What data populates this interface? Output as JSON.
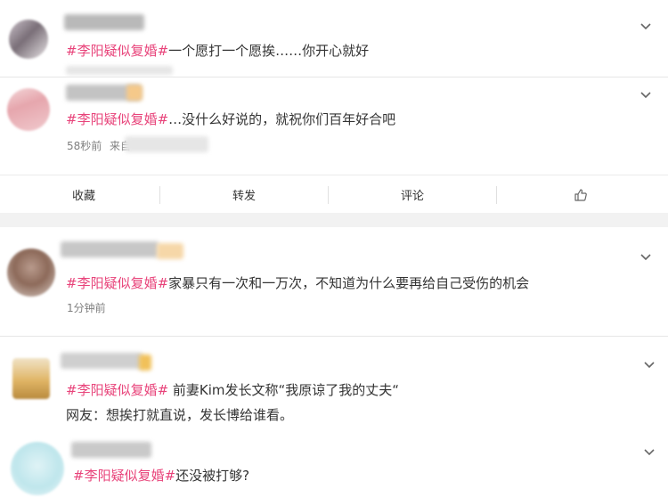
{
  "posts": [
    {
      "tag": "#李阳疑似复婚#",
      "text": "一个愿打一个愿挨……你开心就好"
    },
    {
      "tag": "#李阳疑似复婚#",
      "text": "…没什么好说的，就祝你们百年好合吧",
      "time": "58秒前",
      "source": "来自"
    },
    {
      "tag": "#李阳疑似复婚#",
      "text": "家暴只有一次和一万次，不知道为什么要再给自己受伤的机会",
      "time": "1分钟前"
    },
    {
      "tag": "#李阳疑似复婚#",
      "text": " 前妻Kim发长文称“我原谅了我的丈夫“",
      "line2": "网友：想挨打就直说，发长博给谁看。"
    },
    {
      "tag": "#李阳疑似复婚#",
      "text": "还没被打够?"
    }
  ],
  "actions": {
    "collect": "收藏",
    "forward": "转发",
    "comment": "评论",
    "like_icon": "thumbs-up-icon"
  },
  "icons": {
    "more": "chevron-down-icon"
  },
  "colors": {
    "tag": "#e8437a",
    "meta": "#808080",
    "text": "#333333"
  }
}
